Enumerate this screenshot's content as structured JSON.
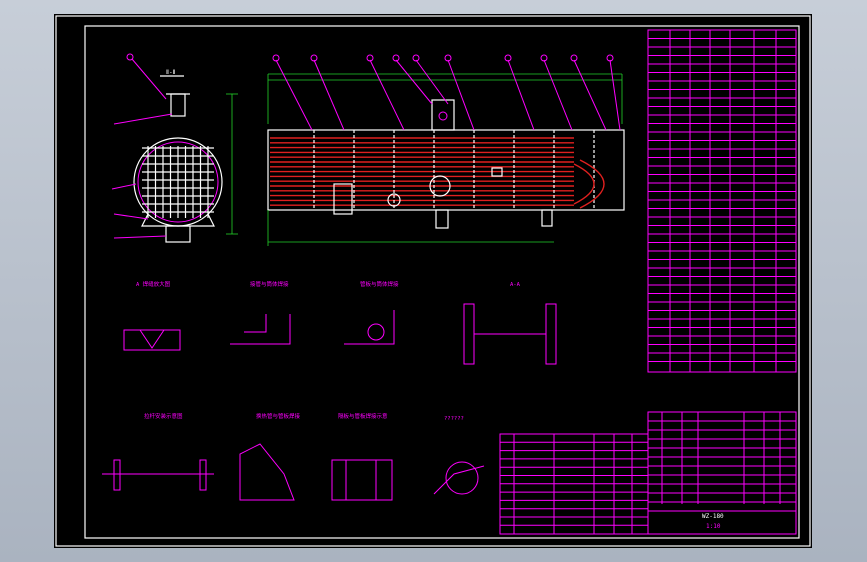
{
  "section_labels": {
    "view_ii": "Ⅱ-Ⅱ",
    "detail_a_title": "A 焊缝放大图",
    "detail_2": "接管与筒体焊接",
    "detail_3": "管板与筒体焊接",
    "detail_4": "A-A",
    "detail_5": "拉杆安装示意图",
    "detail_6": "换热管与管板焊接",
    "detail_7": "隔板与管板焊接示意",
    "detail_8": "??????"
  },
  "title_block": {
    "drawing_no": "WZ-180",
    "scale_text": "1:10"
  },
  "colors": {
    "frame": "#ffffff",
    "linework": "#ff00ff",
    "tubes": "#e0201f",
    "dimensions": "#22d22a",
    "background": "#000000"
  }
}
